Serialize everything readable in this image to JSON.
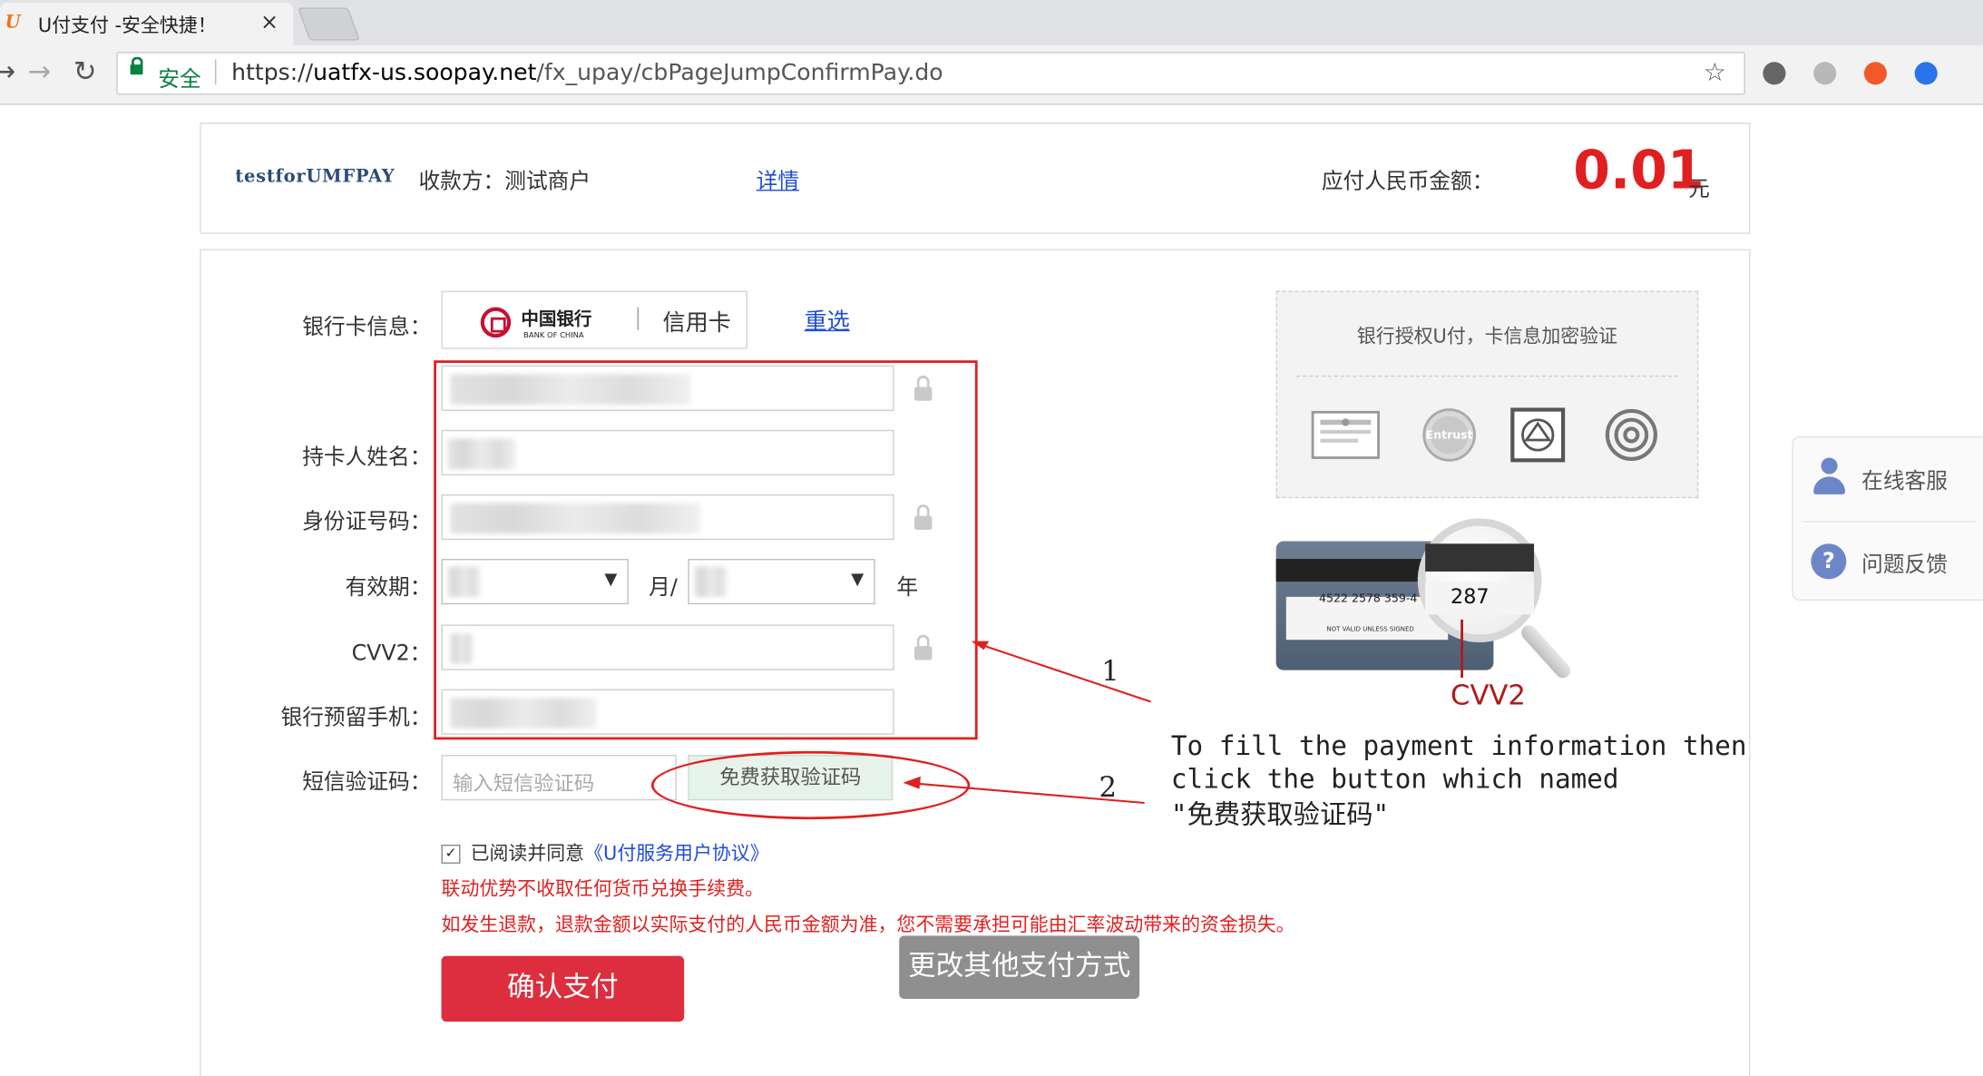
{
  "browser": {
    "tab_title": "U付支付 -安全快捷！",
    "tab_close": "×",
    "secure_label": "安全",
    "url_scheme": "https://",
    "url_host": "uatfx-us.soopay.net",
    "url_path": "/fx_upay/cbPageJumpConfirmPay.do"
  },
  "header": {
    "merchant_logo": "testforUMFPAY",
    "payee": "收款方：测试商户",
    "details_link": "详情",
    "amount_label": "应付人民币金额：",
    "amount": "0.01",
    "amount_unit": "元"
  },
  "form": {
    "bank_card_label": "银行卡信息：",
    "bank_name_cn": "中国银行",
    "bank_name_en": "BANK OF CHINA",
    "card_type": "信用卡",
    "reselect": "重选",
    "holder_name_label": "持卡人姓名：",
    "id_number_label": "身份证号码：",
    "expiry_label": "有效期：",
    "month_suffix": "月/",
    "year_suffix": "年",
    "cvv2_label": "CVV2：",
    "phone_label": "银行预留手机：",
    "sms_label": "短信验证码：",
    "sms_placeholder": "输入短信验证码",
    "sms_button": "免费获取验证码",
    "agree_prefix": "已阅读并同意",
    "agree_link": "《U付服务用户协议》",
    "note_1": "联动优势不收取任何货币兑换手续费。",
    "note_2": "如发生退款，退款金额以实际支付的人民币金额为准，您不需要承担可能由汇率波动带来的资金损失。",
    "confirm_button": "确认支付",
    "other_payment_button": "更改其他支付方式"
  },
  "security": {
    "text": "银行授权U付，卡信息加密验证",
    "seal_entrust": "Entrust"
  },
  "cvv_illustration": {
    "card_number": "4522 2578 359-4",
    "not_valid": "NOT VALID UNLESS SIGNED",
    "cvv_digits": "287",
    "cvv_label": "CVV2"
  },
  "annotation": {
    "marker_1": "1",
    "marker_2": "2",
    "line_1": "To fill the payment information then",
    "line_2": "click the button which named",
    "line_3": "\"免费获取验证码\""
  },
  "sidebar": {
    "online_service": "在线客服",
    "feedback": "问题反馈"
  },
  "colors": {
    "accent_red": "#e02020",
    "confirm_red": "#dd2e3f",
    "link_blue": "#1d4ed8",
    "secure_green": "#0b8043"
  }
}
